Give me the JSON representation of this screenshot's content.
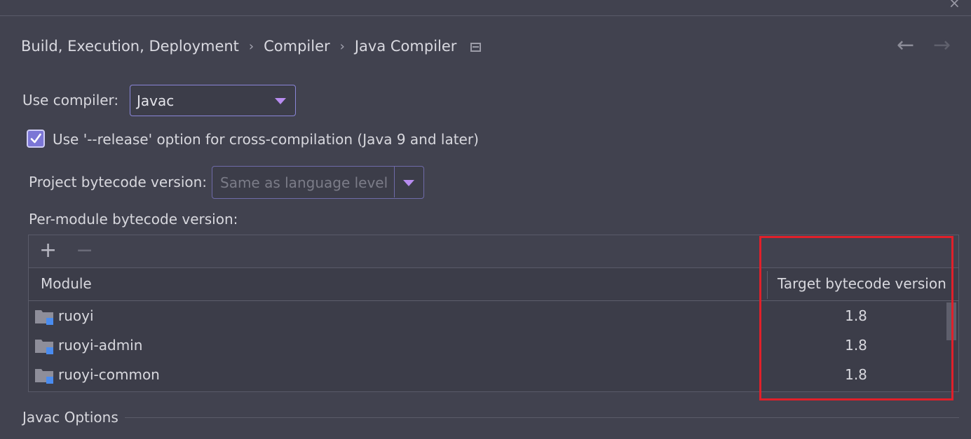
{
  "breadcrumb": {
    "items": [
      "Build, Execution, Deployment",
      "Compiler",
      "Java Compiler"
    ],
    "separator": "›"
  },
  "compiler": {
    "label": "Use compiler:",
    "value": "Javac"
  },
  "release_option": {
    "label": "Use '--release' option for cross-compilation (Java 9 and later)",
    "checked": true
  },
  "project_bytecode": {
    "label": "Project bytecode version:",
    "placeholder": "Same as language level"
  },
  "per_module": {
    "label": "Per-module bytecode version:",
    "toolbar": {
      "add": "+",
      "remove": "−"
    },
    "columns": [
      "Module",
      "Target bytecode version"
    ],
    "rows": [
      {
        "module": "ruoyi",
        "target": "1.8"
      },
      {
        "module": "ruoyi-admin",
        "target": "1.8"
      },
      {
        "module": "ruoyi-common",
        "target": "1.8"
      }
    ]
  },
  "javac_options": {
    "label": "Javac Options"
  },
  "nav": {
    "back": "←",
    "forward": "→",
    "close": "×"
  },
  "colors": {
    "background": "#41424f",
    "accent": "#8a86d8",
    "dropdown_arrow": "#b88cf0",
    "highlight": "#e0202a",
    "module_badge": "#4a8cf0"
  },
  "icons": {
    "breadcrumb_tail": "window-icon",
    "module": "module-folder-icon"
  }
}
